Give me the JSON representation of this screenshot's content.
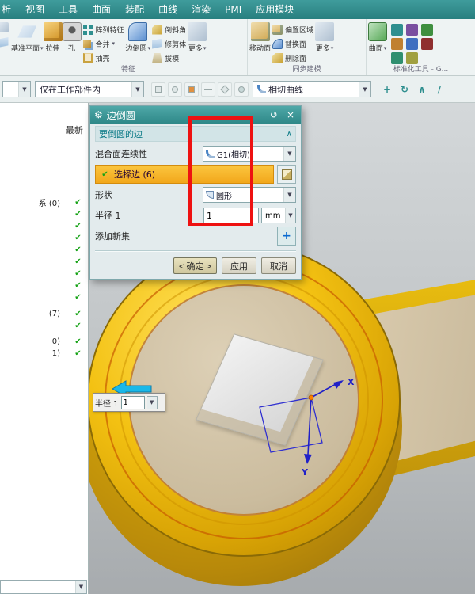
{
  "icons": {
    "check": "✔",
    "dropdown": "▼",
    "caret": "▾",
    "close": "×",
    "reset": "↺",
    "collapse": "∧",
    "gear": "⚙",
    "add": "+",
    "refresh": "↻",
    "slash": "/"
  },
  "menubar": {
    "items": [
      "析",
      "视图",
      "工具",
      "曲面",
      "装配",
      "曲线",
      "渲染",
      "PMI",
      "应用模块"
    ]
  },
  "ribbon": {
    "groups": [
      {
        "label": "特征"
      },
      {
        "label": "同步建模"
      },
      {
        "label": "标准化工具 - G..."
      }
    ],
    "tools": {
      "datum_plane": "基准平面",
      "extrude": "拉伸",
      "hole": "孔",
      "pattern": "阵列特征",
      "unite": "合并",
      "shell": "抽壳",
      "edge_blend": "边倒圆",
      "chamfer": "倒斜角",
      "trim_body": "修剪体",
      "draft": "拔模",
      "more": "更多",
      "move_face": "移动面",
      "offset_region": "偏置区域",
      "replace_face": "替换面",
      "delete_face": "删除面",
      "more2": "更多",
      "surface": "曲面"
    }
  },
  "selection_bar": {
    "scope_value": "仅在工作部件内",
    "curve_rule_value": "相切曲线"
  },
  "navigator": {
    "header": "最新",
    "rows": [
      {
        "text": "系 (0)"
      },
      {
        "text": ""
      },
      {
        "text": ""
      },
      {
        "text": ""
      },
      {
        "text": ""
      },
      {
        "text": ""
      },
      {
        "text": ""
      },
      {
        "text": ""
      },
      {
        "text": ""
      },
      {
        "text": "(7)"
      },
      {
        "text": ""
      },
      {
        "text": "0)"
      },
      {
        "text": "1)"
      }
    ]
  },
  "dialog": {
    "title": "边倒圆",
    "section_header": "要倒圆的边",
    "continuity_label": "混合面连续性",
    "continuity_value": "G1(相切)",
    "select_edge_label": "选择边 (6)",
    "shape_label": "形状",
    "shape_value": "圆形",
    "radius_label": "半径 1",
    "radius_value": "1",
    "radius_unit": "mm",
    "add_new_set_label": "添加新集",
    "ok_label": "< 确定 >",
    "apply_label": "应用",
    "cancel_label": "取消"
  },
  "viewport": {
    "onscreen_label": "半径 1",
    "onscreen_value": "1",
    "axis_x": "X",
    "axis_y": "Y"
  }
}
